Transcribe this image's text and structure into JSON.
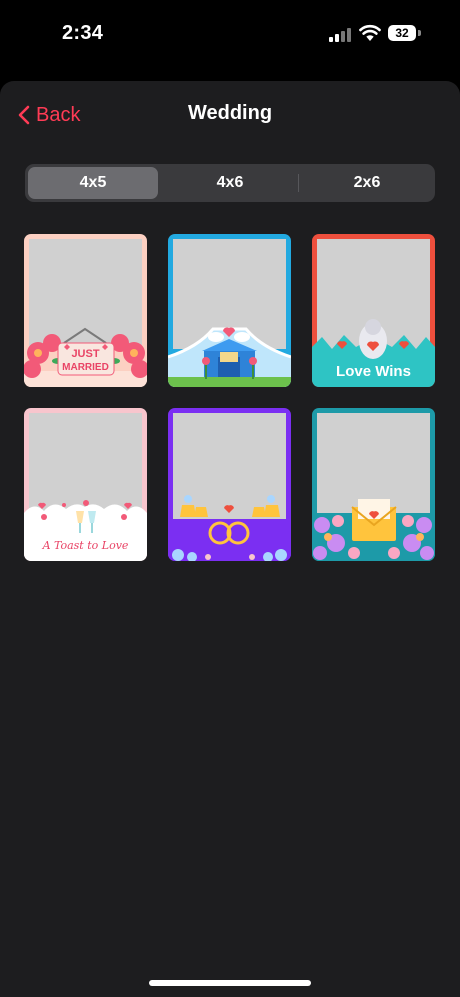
{
  "status": {
    "time": "2:34",
    "battery": "32"
  },
  "nav": {
    "back_label": "Back",
    "title": "Wedding"
  },
  "size_tabs": [
    {
      "label": "4x5",
      "selected": true
    },
    {
      "label": "4x6",
      "selected": false
    },
    {
      "label": "2x6",
      "selected": false
    }
  ],
  "frames": [
    {
      "name": "just-married",
      "sign_line1": "JUST",
      "sign_line2": "MARRIED",
      "border_color": "#fcd0c2"
    },
    {
      "name": "wedding-chapel",
      "border_color": "#22a9e0"
    },
    {
      "name": "love-wins",
      "caption": "Love Wins",
      "border_color": "#ee4f3d"
    },
    {
      "name": "a-toast-to-love",
      "caption": "A Toast to Love",
      "border_color": "#f8c5cd"
    },
    {
      "name": "golden-rings",
      "border_color": "#7b2ff2"
    },
    {
      "name": "love-letter",
      "border_color": "#1d9aa8"
    }
  ],
  "colors": {
    "accent": "#ff3b55",
    "sheet_bg": "#1d1d1f",
    "segment_bg": "#3a3a3d",
    "segment_active": "#6c6c70"
  }
}
